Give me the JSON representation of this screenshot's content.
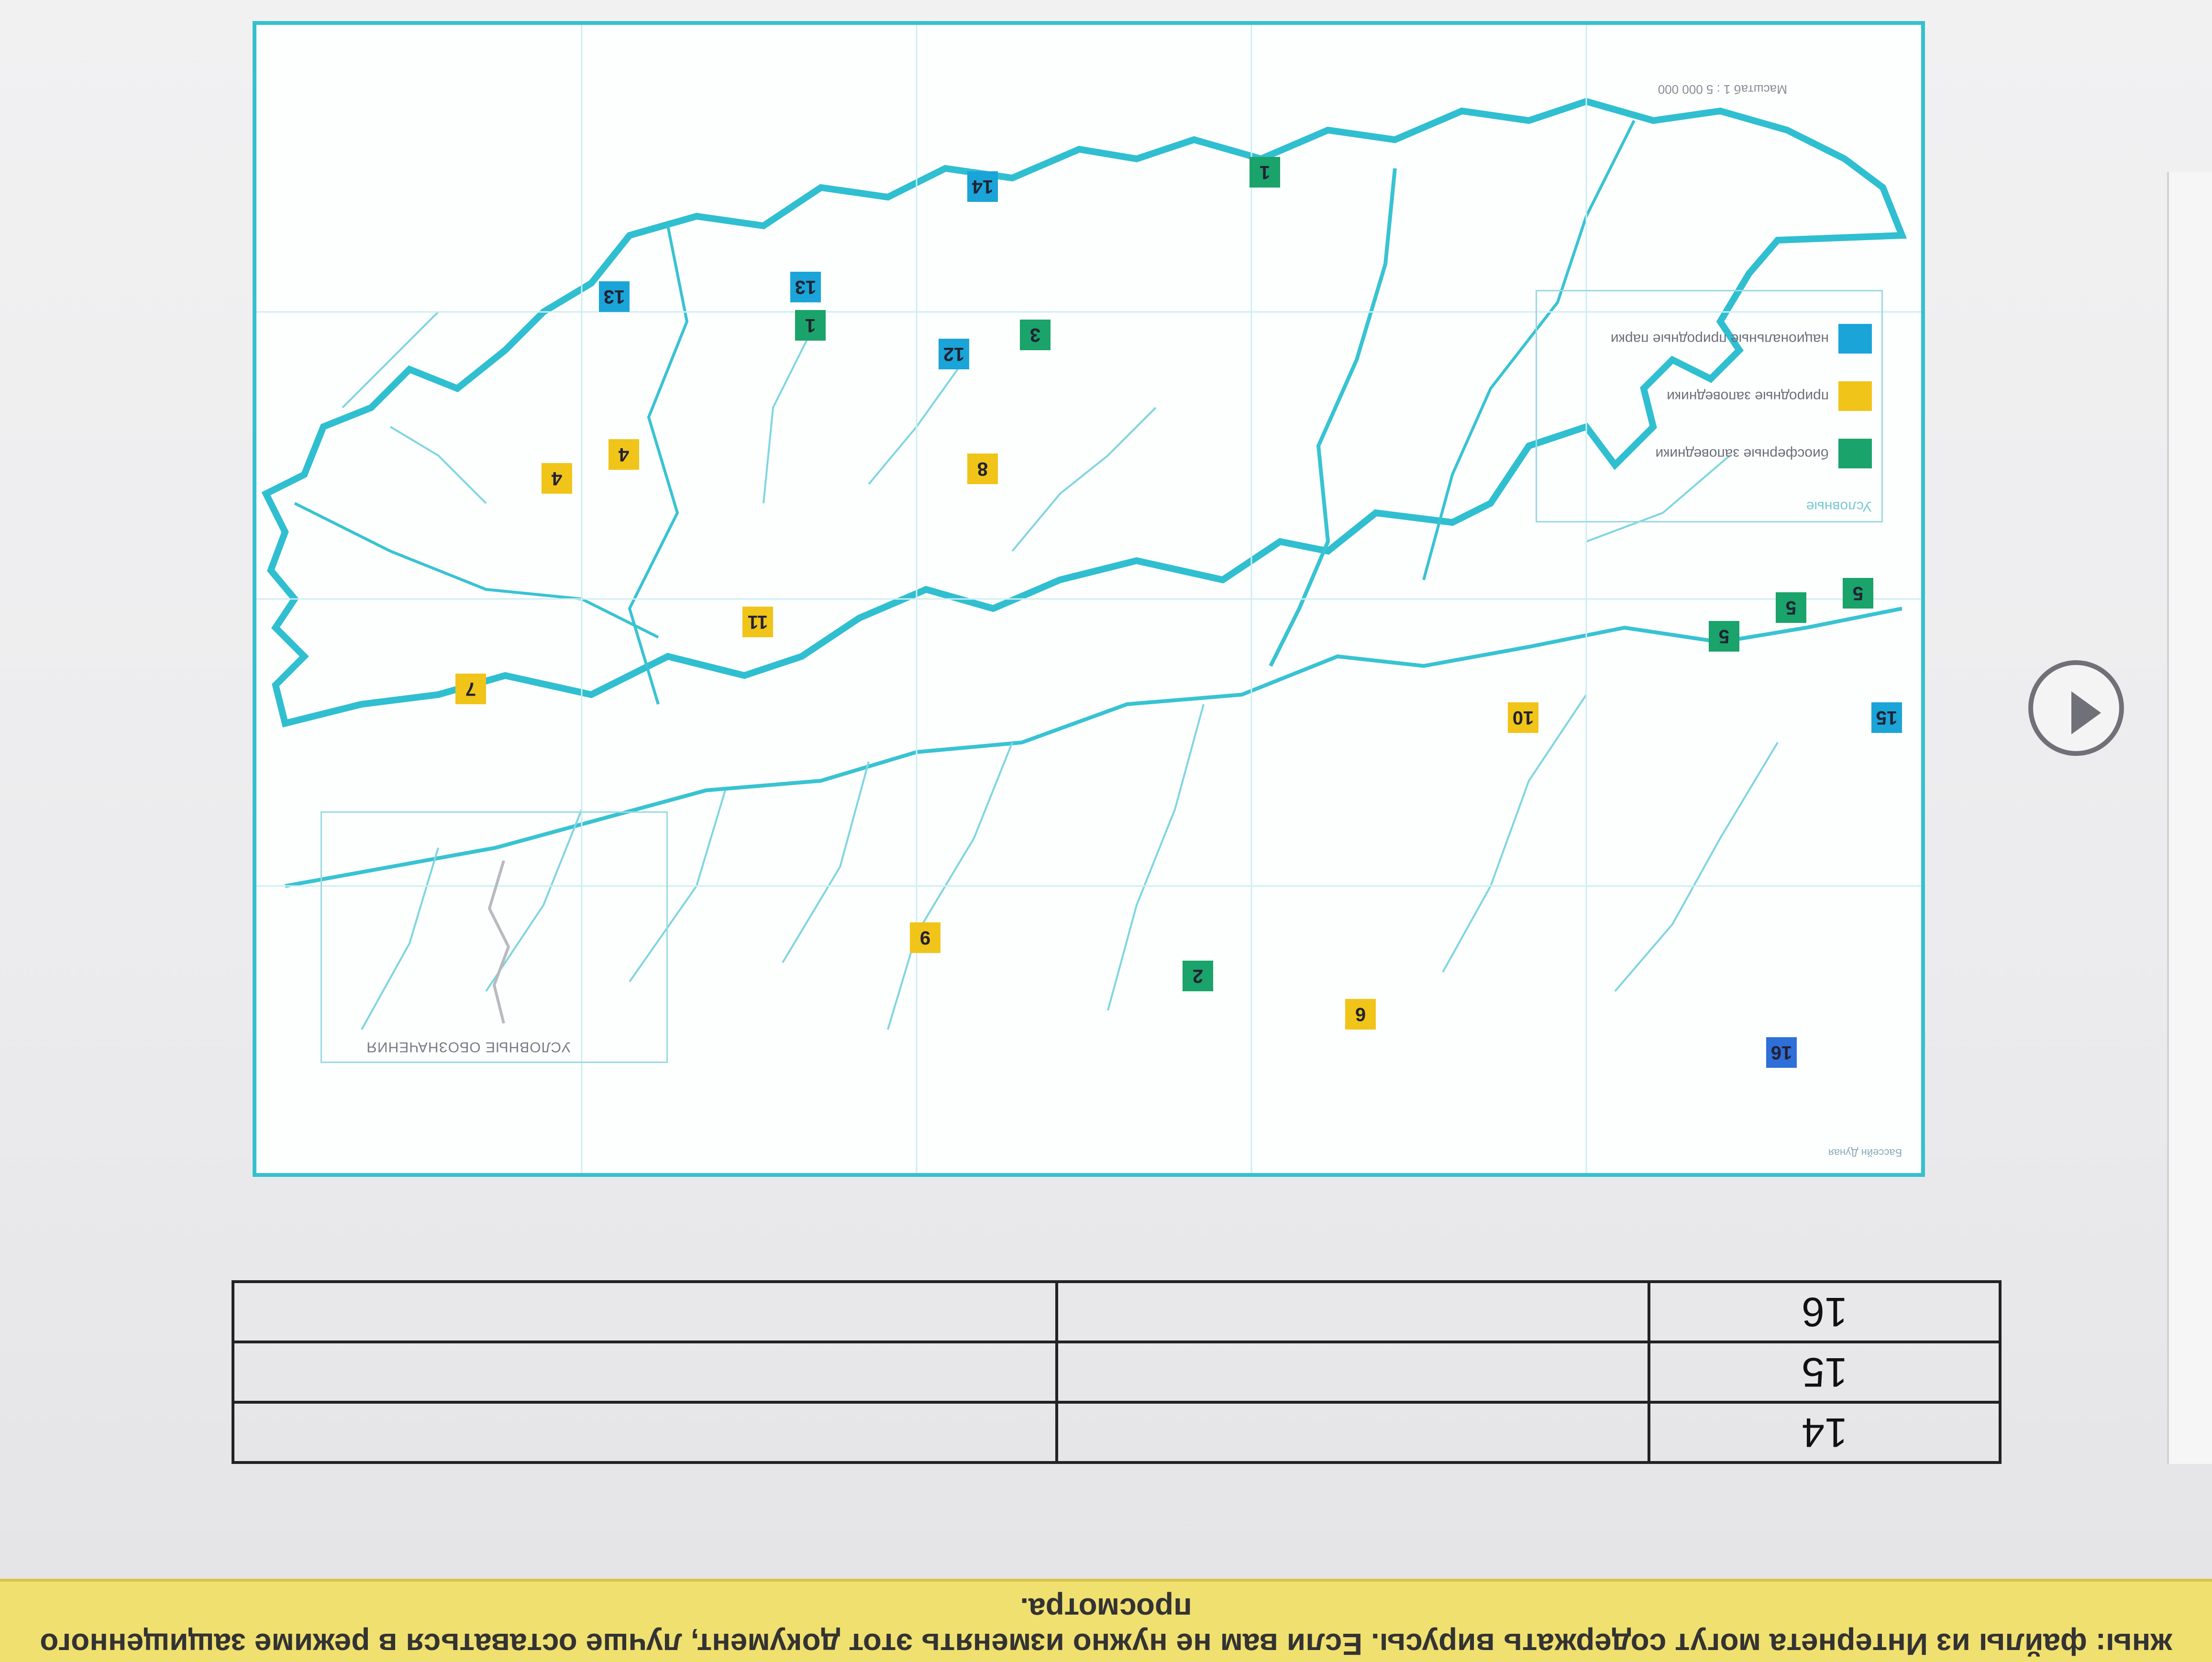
{
  "map": {
    "legend": {
      "title": "Условные",
      "items": [
        {
          "label": "биосферные заповедники",
          "color": "#1aa36a"
        },
        {
          "label": "природные заповедники",
          "color": "#f0c419"
        },
        {
          "label": "национальные природные парки",
          "color": "#1aa4d8"
        }
      ]
    },
    "scale_label": "Масштаб 1 : 5 000 000",
    "inset_label": "УСЛОВНЫЕ ОБОЗНАЧЕНИЯ",
    "corner_note": "Бассейн Дуная",
    "markers": [
      {
        "label": "1",
        "kind": "green"
      },
      {
        "label": "1",
        "kind": "green"
      },
      {
        "label": "2",
        "kind": "green"
      },
      {
        "label": "3",
        "kind": "green"
      },
      {
        "label": "4",
        "kind": "yellow"
      },
      {
        "label": "4",
        "kind": "yellow"
      },
      {
        "label": "5",
        "kind": "green"
      },
      {
        "label": "5",
        "kind": "green"
      },
      {
        "label": "5",
        "kind": "green"
      },
      {
        "label": "6",
        "kind": "yellow"
      },
      {
        "label": "7",
        "kind": "yellow"
      },
      {
        "label": "8",
        "kind": "yellow"
      },
      {
        "label": "9",
        "kind": "yellow"
      },
      {
        "label": "10",
        "kind": "yellow"
      },
      {
        "label": "11",
        "kind": "yellow"
      },
      {
        "label": "12",
        "kind": "blue"
      },
      {
        "label": "13",
        "kind": "blue"
      },
      {
        "label": "13",
        "kind": "blue"
      },
      {
        "label": "14",
        "kind": "blue"
      },
      {
        "label": "15",
        "kind": "blue"
      },
      {
        "label": "16",
        "kind": "blue"
      }
    ]
  },
  "table": {
    "rows": [
      {
        "num": "16",
        "col2": "",
        "col3": ""
      },
      {
        "num": "15",
        "col2": "",
        "col3": ""
      },
      {
        "num": "14",
        "col2": "",
        "col3": ""
      }
    ]
  },
  "warning_bar": {
    "text": "жны: файлы из Интернета могут содержать вирусы. Если вам не нужно изменять этот документ, лучше оставаться в режиме защищенного просмотра."
  },
  "colors": {
    "green": "#1aa36a",
    "yellow": "#f0c419",
    "blue": "#1aa4d8"
  }
}
